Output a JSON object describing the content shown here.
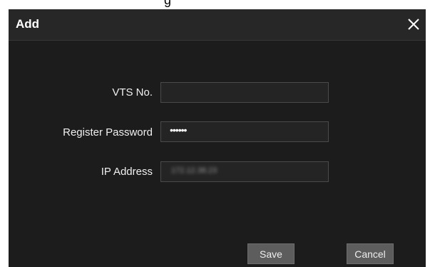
{
  "dialog": {
    "title": "Add",
    "close_icon": "close-icon"
  },
  "form": {
    "vts_no": {
      "label": "VTS No.",
      "value": ""
    },
    "register_password": {
      "label": "Register Password",
      "value": "••••••"
    },
    "ip_address": {
      "label": "IP Address",
      "value": "172.12.38.23"
    }
  },
  "buttons": {
    "save_label": "Save",
    "cancel_label": "Cancel"
  },
  "colors": {
    "dialog_bg": "#1c1c1c",
    "header_bg": "#272727",
    "input_bg": "#242424",
    "button_bg": "#5d5d5d",
    "text": "#ffffff"
  }
}
